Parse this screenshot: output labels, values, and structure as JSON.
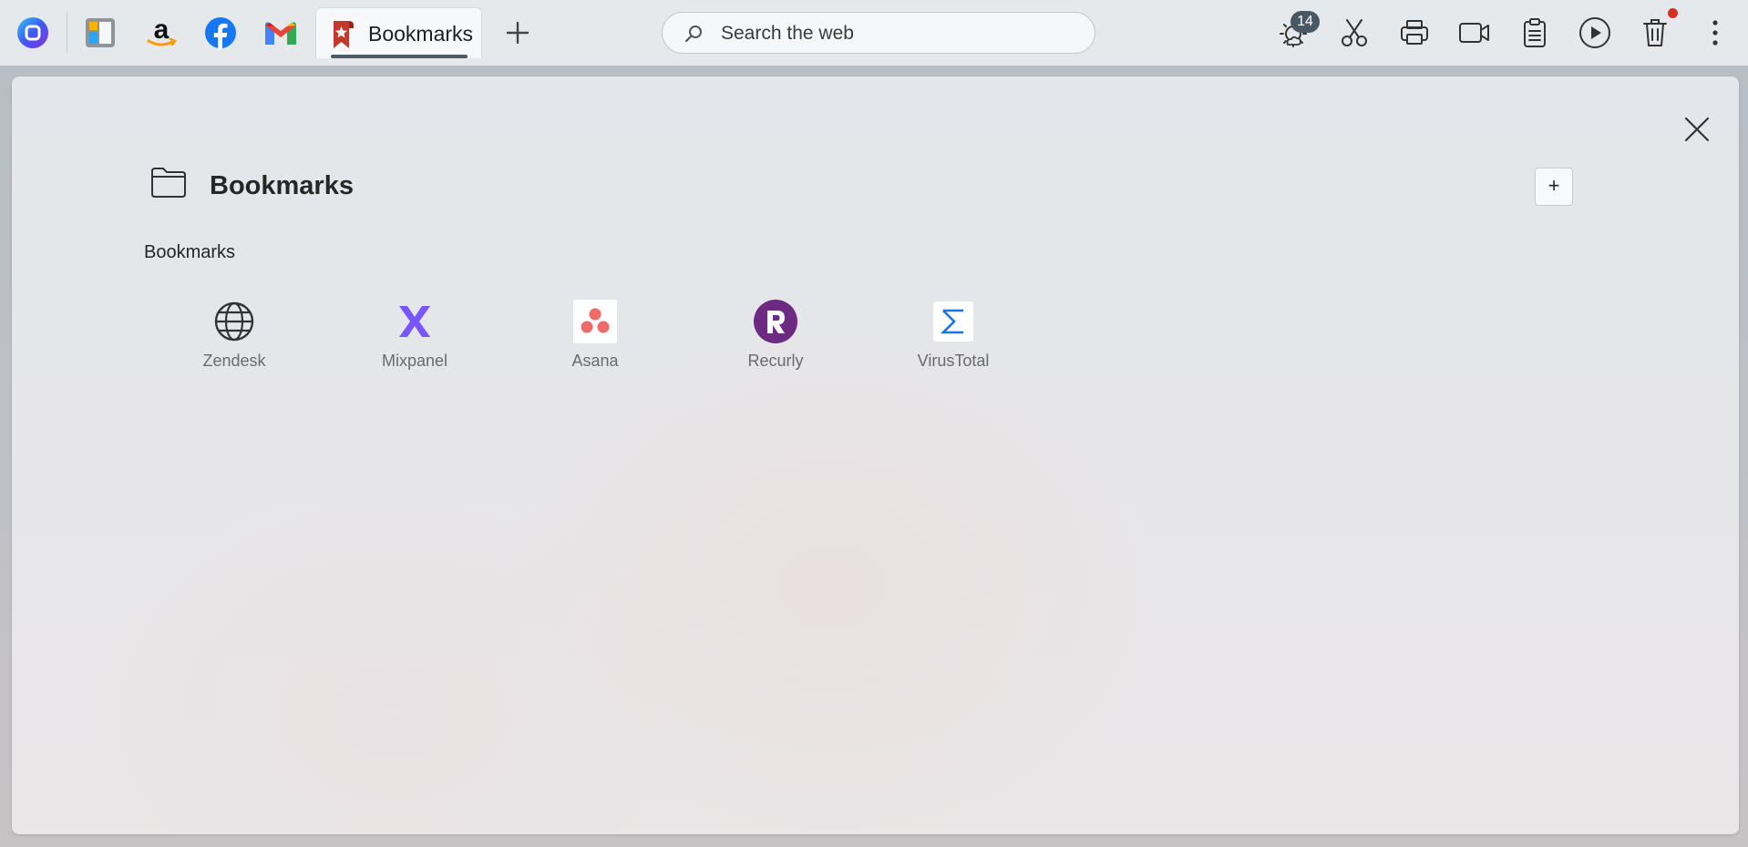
{
  "toolbar": {
    "tab_title": "Bookmarks",
    "search_placeholder": "Search the web",
    "weather_badge": "14"
  },
  "quicklinks": [
    "browser-logo",
    "collections",
    "amazon",
    "facebook",
    "gmail"
  ],
  "panel": {
    "title": "Bookmarks",
    "add_label": "+",
    "section_label": "Bookmarks",
    "bookmarks": [
      {
        "label": "Zendesk",
        "icon": "globe-icon"
      },
      {
        "label": "Mixpanel",
        "icon": "mixpanel-icon"
      },
      {
        "label": "Asana",
        "icon": "asana-icon"
      },
      {
        "label": "Recurly",
        "icon": "recurly-icon"
      },
      {
        "label": "VirusTotal",
        "icon": "virustotal-icon"
      }
    ]
  },
  "colors": {
    "mixpanel": "#7856ff",
    "asana": "#f06a6a",
    "recurly": "#6c2a82",
    "virustotal": "#1a73e8",
    "notification": "#d93025"
  }
}
